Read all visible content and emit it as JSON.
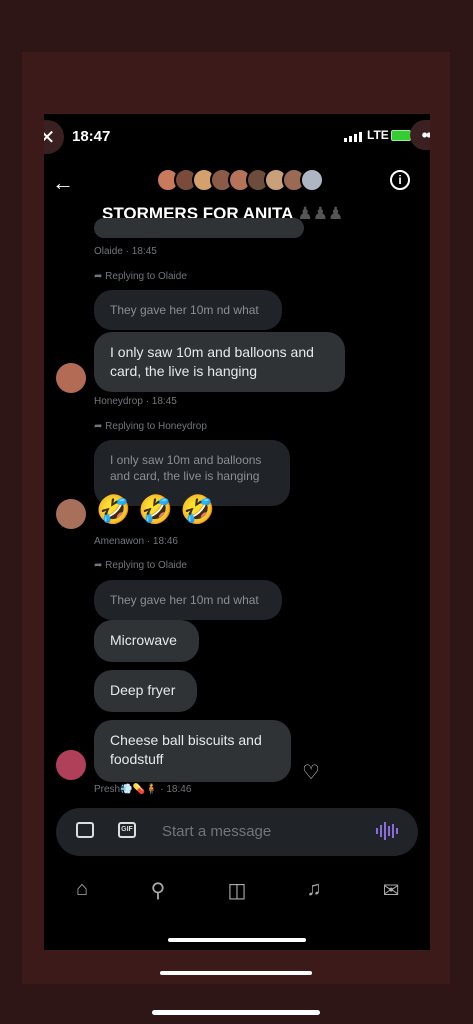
{
  "status": {
    "time": "18:47",
    "network": "LTE"
  },
  "header": {
    "title": "STORMERS FOR ANITA",
    "title_emoji": "♟♟♟"
  },
  "messages": {
    "m0_meta": "Olaide · 18:45",
    "m1_reply": "Replying to Olaide",
    "m1_quote": "They gave her 10m nd what",
    "m1_text": "I only saw 10m and balloons and card, the live is hanging",
    "m1_meta": "Honeydrop · 18:45",
    "m2_reply": "Replying to Honeydrop",
    "m2_quote": "I only saw 10m and balloons and card, the live is hanging",
    "m2_emojis": [
      "🤣",
      "🤣",
      "🤣"
    ],
    "m2_meta": "Amenawon · 18:46",
    "m3_reply": "Replying to Olaide",
    "m3_quote": "They gave her 10m nd what",
    "m3_b1": "Microwave",
    "m3_b2": "Deep fryer",
    "m3_b3": "Cheese ball biscuits and foodstuff",
    "m3_meta": "Presh💨💊🧍 · 18:46"
  },
  "composer": {
    "placeholder": "Start a message",
    "gif_label": "GIF"
  },
  "tabs": [
    "home",
    "search",
    "grok",
    "notifications",
    "messages"
  ],
  "icons": {
    "close": "close-icon",
    "more": "more-icon",
    "back": "back-arrow-icon",
    "info": "info-icon",
    "image": "image-icon",
    "gif": "gif-icon",
    "voice": "voice-icon",
    "heart": "add-reaction-icon"
  }
}
